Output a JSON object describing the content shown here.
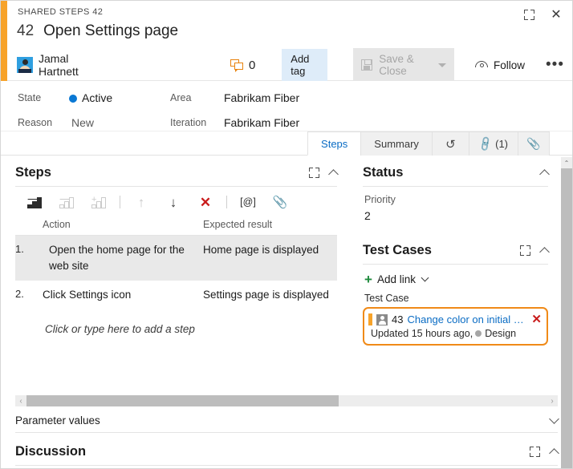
{
  "window": {
    "breadcrumb": "SHARED STEPS 42",
    "expand_icon": "expand-icon",
    "close_icon": "close-icon",
    "close_glyph": "✕"
  },
  "header": {
    "work_item_id": "42",
    "title": "Open Settings page",
    "author": "Jamal Hartnett",
    "avatar_icon": "user-avatar-icon",
    "comment_icon": "comment-icon",
    "comment_count": "0",
    "add_tag_label": "Add tag",
    "save_close_label": "Save & Close",
    "save_icon": "save-disk-icon",
    "save_dropdown_icon": "caret-down-icon",
    "follow_label": "Follow",
    "follow_icon": "eye-icon",
    "more_label": "•••",
    "accent_color": "#f7a32a"
  },
  "fields": {
    "state_label": "State",
    "state_value": "Active",
    "state_color": "#0a78d4",
    "reason_label": "Reason",
    "reason_value": "New",
    "area_label": "Area",
    "area_value": "Fabrikam Fiber",
    "iteration_label": "Iteration",
    "iteration_value": "Fabrikam Fiber"
  },
  "tabs": [
    {
      "label": "Steps",
      "active": true,
      "icon": ""
    },
    {
      "label": "Summary",
      "active": false,
      "icon": ""
    },
    {
      "label": "",
      "active": false,
      "icon": "history-icon",
      "glyph": "↺"
    },
    {
      "label": "(1)",
      "active": false,
      "icon": "link-icon",
      "glyph": "🔗"
    },
    {
      "label": "",
      "active": false,
      "icon": "attachment-icon",
      "glyph": "📎"
    }
  ],
  "steps_section": {
    "title": "Steps",
    "expand_icon": "expand-icon",
    "collapse_icon": "chevron-up-icon",
    "toolbar": [
      {
        "name": "insert-step-icon",
        "state": "enabled"
      },
      {
        "name": "add-step-icon",
        "state": "disabled"
      },
      {
        "name": "add-shared-step-icon",
        "state": "disabled"
      },
      {
        "name": "move-up-icon",
        "state": "disabled",
        "glyph": "↑"
      },
      {
        "name": "move-down-icon",
        "state": "enabled",
        "glyph": "↓"
      },
      {
        "name": "delete-step-icon",
        "state": "enabled",
        "glyph": "✕"
      },
      {
        "name": "insert-parameter-icon",
        "state": "enabled",
        "glyph": "[@]"
      },
      {
        "name": "attach-file-icon",
        "state": "enabled",
        "glyph": "📎"
      }
    ],
    "columns": {
      "num": "",
      "action": "Action",
      "expected": "Expected result"
    },
    "rows": [
      {
        "num": "1.",
        "action": "Open the home page for the web site",
        "expected": "Home page is displayed",
        "selected": true
      },
      {
        "num": "2.",
        "action": "Click Settings icon",
        "expected": "Settings page is displayed",
        "selected": false
      }
    ],
    "add_step_hint": "Click or type here to add a step",
    "hscroll_left_icon": "scroll-left-icon",
    "hscroll_right_icon": "scroll-right-icon",
    "hscroll_left_glyph": "‹",
    "hscroll_right_glyph": "›"
  },
  "parameter_values": {
    "label": "Parameter values",
    "expand_icon": "chevron-down-icon"
  },
  "discussion": {
    "title": "Discussion",
    "expand_icon": "expand-icon",
    "collapse_icon": "chevron-up-icon"
  },
  "status_section": {
    "title": "Status",
    "collapse_icon": "chevron-up-icon",
    "priority_label": "Priority",
    "priority_value": "2"
  },
  "test_cases_section": {
    "title": "Test Cases",
    "expand_icon": "expand-icon",
    "collapse_icon": "chevron-up-icon",
    "add_link_label": "Add link",
    "add_link_icon": "plus-icon",
    "add_link_caret": "chevron-down-icon",
    "group_label": "Test Case",
    "link": {
      "id": "43",
      "title": "Change color on initial view",
      "subtitle_prefix": "Updated 15 hours ago,",
      "state": "Design",
      "state_dot_color": "#a6a6a6",
      "icon": "test-case-icon",
      "remove_icon": "remove-link-icon",
      "remove_glyph": "✕",
      "highlight_color": "#f08a18"
    }
  },
  "scrollbars": {
    "vertical_up_icon": "scroll-up-icon",
    "vertical_up_glyph": "⌃"
  }
}
